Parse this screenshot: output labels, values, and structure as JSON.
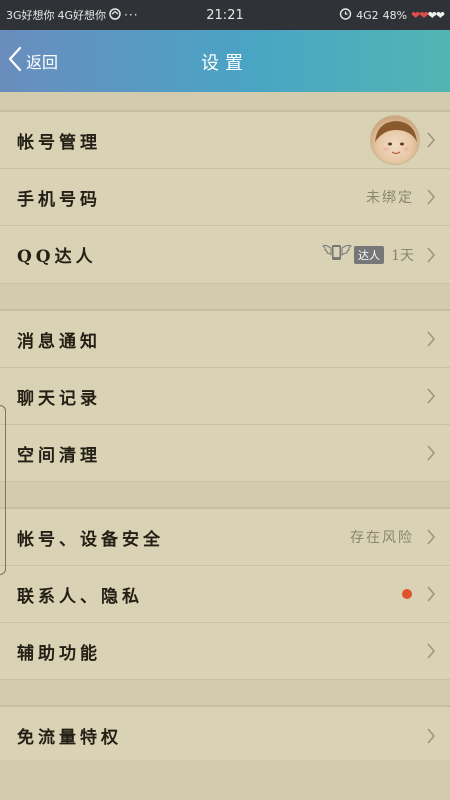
{
  "status_bar": {
    "carrier1": "3G好想你",
    "carrier2": "4G好想你",
    "dots": "···",
    "time": "21:21",
    "network": "4G2",
    "battery": "48%",
    "hearts_red": "❤❤",
    "hearts_white": "❤❤"
  },
  "nav": {
    "back_label": "返回",
    "title": "设置"
  },
  "groups": [
    {
      "rows": [
        {
          "label": "帐号管理",
          "value": ""
        },
        {
          "label": "手机号码",
          "value": "未绑定"
        },
        {
          "label": "QQ达人",
          "badge": "达人",
          "value": "1天"
        }
      ]
    },
    {
      "rows": [
        {
          "label": "消息通知",
          "value": ""
        },
        {
          "label": "聊天记录",
          "value": ""
        },
        {
          "label": "空间清理",
          "value": ""
        }
      ]
    },
    {
      "rows": [
        {
          "label": "帐号、设备安全",
          "value": "存在风险"
        },
        {
          "label": "联系人、隐私",
          "value": ""
        },
        {
          "label": "辅助功能",
          "value": ""
        }
      ]
    },
    {
      "rows": [
        {
          "label": "免流量特权",
          "value": ""
        }
      ]
    }
  ],
  "colors": {
    "background": "#d9d2b4",
    "red_dot": "#e0522e",
    "nav_gradient_start": "#6a8dbe",
    "nav_gradient_end": "#52b5b4"
  }
}
